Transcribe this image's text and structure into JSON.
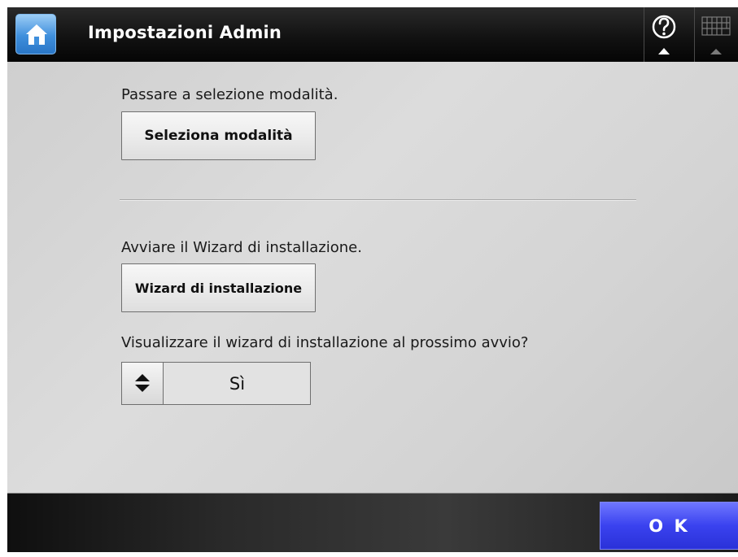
{
  "header": {
    "title": "Impostazioni Admin",
    "home_icon": "home-icon",
    "help_icon": "question-circle-icon",
    "keyboard_icon": "keyboard-icon"
  },
  "mode_section": {
    "label": "Passare a selezione modalità.",
    "button_label": "Seleziona modalità"
  },
  "wizard_section": {
    "label": "Avviare il Wizard di installazione.",
    "button_label": "Wizard di installazione",
    "startup_question": "Visualizzare il wizard di installazione al prossimo avvio?",
    "startup_value": "Sì",
    "spinner_icon": "up-down-arrows-icon"
  },
  "footer": {
    "ok_label": "O K",
    "ok_color": "#3a42ef"
  },
  "colors": {
    "header_bg": "#121212",
    "home_button": "#3f8fdc",
    "content_bg": "#d6d6d6"
  }
}
